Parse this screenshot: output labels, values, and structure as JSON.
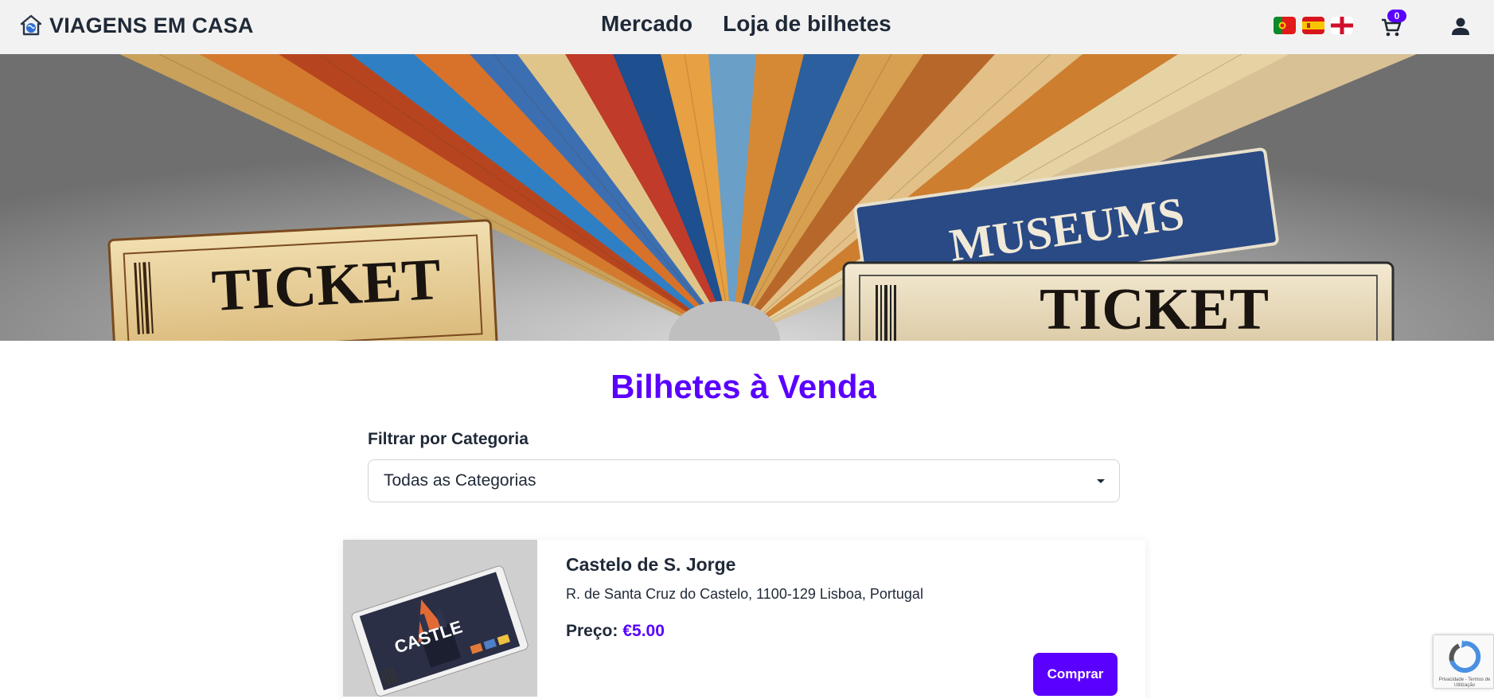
{
  "header": {
    "brand": "VIAGENS EM CASA",
    "brand_icon": "house-globe-icon",
    "nav": [
      {
        "label": "Mercado"
      },
      {
        "label": "Loja de bilhetes"
      }
    ],
    "languages": [
      "pt",
      "es",
      "en"
    ],
    "cart_count": "0",
    "accent_color": "#5a00ff"
  },
  "hero": {
    "banner_text_left": "TICKET",
    "banner_text_right": "TICKET",
    "banner_text_top": "MUSEUMS"
  },
  "main": {
    "title": "Bilhetes à Venda",
    "filter_label": "Filtrar por Categoria",
    "filter_value": "Todas as Categorias",
    "tickets": [
      {
        "name": "Castelo de S. Jorge",
        "address": "R. de Santa Cruz do Castelo, 1100-129 Lisboa, Portugal",
        "price_label": "Preço:",
        "price": "€5.00",
        "buy_label": "Comprar",
        "image_text": "CASTLE"
      }
    ]
  },
  "recaptcha": {
    "text": "Privacidade - Termos de Utilização"
  }
}
